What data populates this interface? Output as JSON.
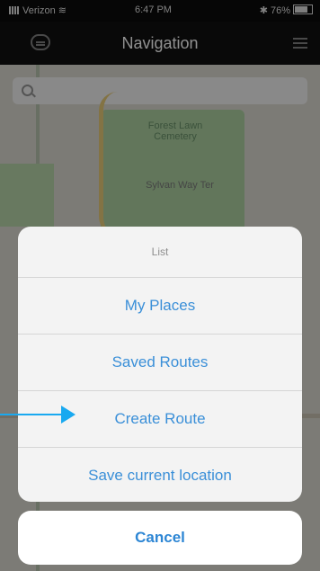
{
  "status_bar": {
    "carrier": "Verizon",
    "time": "6:47 PM",
    "battery": "76%"
  },
  "nav_bar": {
    "title": "Navigation"
  },
  "map": {
    "label_cemetery": "Forest Lawn Cemetery",
    "label_road": "Sylvan Way Ter"
  },
  "action_sheet": {
    "title": "List",
    "items": [
      "My Places",
      "Saved Routes",
      "Create Route",
      "Save current location"
    ],
    "cancel_label": "Cancel"
  },
  "colors": {
    "action_blue": "#3a8fd8",
    "annotation_arrow": "#19a9f0"
  }
}
